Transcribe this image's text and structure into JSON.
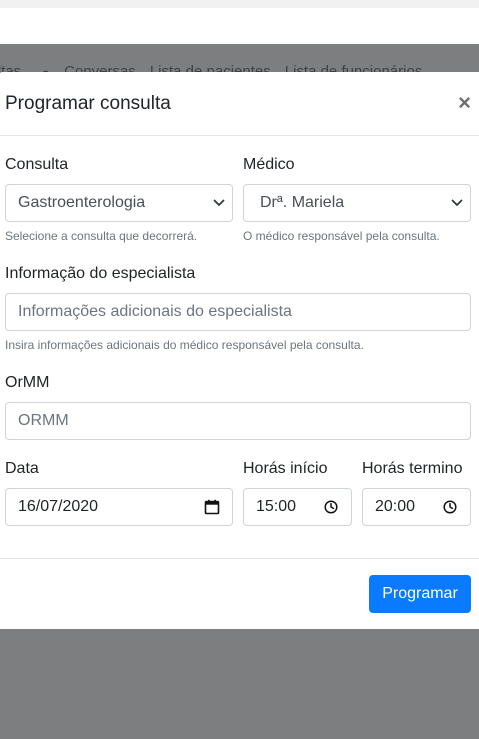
{
  "navbar": {
    "items": [
      "sultas",
      "Conversas",
      "Lista de pacientes",
      "Lista de funcionários"
    ]
  },
  "modal": {
    "title": "Programar consulta",
    "close_symbol": "×",
    "consulta": {
      "label": "Consulta",
      "value": "Gastroenterologia",
      "help": "Selecione a consulta que decorrerá."
    },
    "medico": {
      "label": "Médico",
      "value": "Drª. Mariela",
      "help": "O médico responsável pela consulta."
    },
    "especialista": {
      "label": "Informação do especialista",
      "placeholder": "Informações adicionais do especialista",
      "help": "Insira informações adicionais do médico responsável pela consulta."
    },
    "ormm": {
      "label": "OrMM",
      "placeholder": "ORMM"
    },
    "data": {
      "label": "Data",
      "value": "16/07/2020"
    },
    "hora_inicio": {
      "label": "Horás início",
      "value": "15:00"
    },
    "hora_termino": {
      "label": "Horás termino",
      "value": "20:00"
    },
    "submit_label": "Programar"
  },
  "colors": {
    "primary": "#0a7bff",
    "backdrop": "#7d7e80",
    "muted": "#6c757d"
  },
  "icons": {
    "select": "chevron-down-icon",
    "date": "calendar-icon",
    "time": "clock-icon",
    "close": "close-icon"
  }
}
